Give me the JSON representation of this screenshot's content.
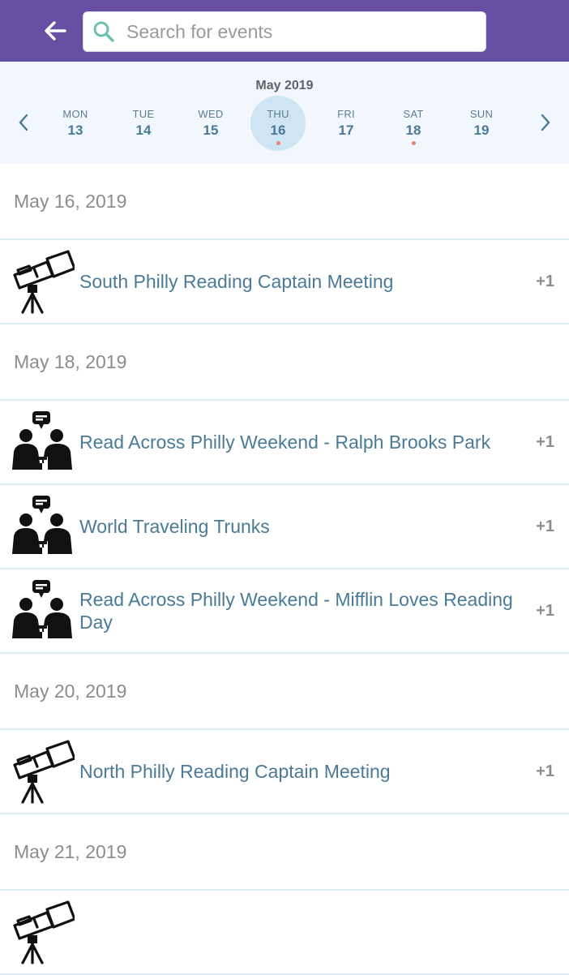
{
  "search": {
    "placeholder": "Search for events"
  },
  "calendar": {
    "month": "May 2019",
    "days": [
      {
        "name": "MON",
        "num": "13",
        "selected": false,
        "has_event": false
      },
      {
        "name": "TUE",
        "num": "14",
        "selected": false,
        "has_event": false
      },
      {
        "name": "WED",
        "num": "15",
        "selected": false,
        "has_event": false
      },
      {
        "name": "THU",
        "num": "16",
        "selected": true,
        "has_event": true
      },
      {
        "name": "FRI",
        "num": "17",
        "selected": false,
        "has_event": false
      },
      {
        "name": "SAT",
        "num": "18",
        "selected": false,
        "has_event": true
      },
      {
        "name": "SUN",
        "num": "19",
        "selected": false,
        "has_event": false
      }
    ]
  },
  "events": [
    {
      "date": "May 16, 2019",
      "items": [
        {
          "title": "South Philly Reading Captain Meeting",
          "count": "+1",
          "icon": "telescope-icon"
        }
      ]
    },
    {
      "date": "May 18, 2019",
      "items": [
        {
          "title": "Read Across Philly Weekend - Ralph Brooks Park",
          "count": "+1",
          "icon": "people-talking-icon"
        },
        {
          "title": "World Traveling Trunks",
          "count": "+1",
          "icon": "people-talking-icon"
        },
        {
          "title": "Read Across Philly Weekend - Mifflin Loves Reading Day",
          "count": "+1",
          "icon": "people-talking-icon"
        }
      ]
    },
    {
      "date": "May 20, 2019",
      "items": [
        {
          "title": "North Philly Reading Captain Meeting",
          "count": "+1",
          "icon": "telescope-icon"
        }
      ]
    },
    {
      "date": "May 21, 2019",
      "items": [
        {
          "title": "",
          "count": "",
          "icon": "telescope-icon"
        }
      ]
    }
  ],
  "colors": {
    "header": "#6750a4",
    "calendar_bg": "#f1f7fc",
    "selected_day": "#cfe5f3",
    "event_dot": "#e8846b",
    "event_title": "#4a7a96"
  }
}
